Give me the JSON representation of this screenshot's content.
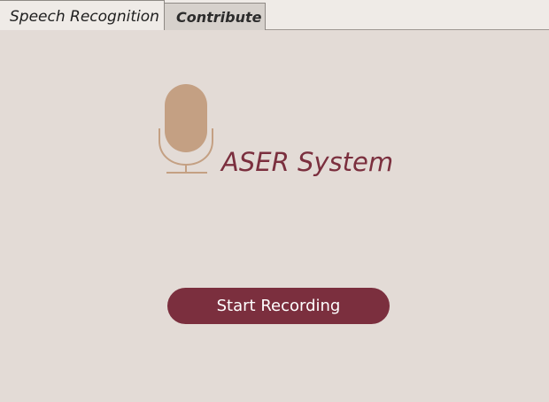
{
  "tabs": [
    {
      "label": "Speech Recognition",
      "active": true
    },
    {
      "label": "Contribute",
      "active": false
    }
  ],
  "main": {
    "logo_icon": "microphone-icon",
    "brand_title": "ASER System",
    "record_button_label": "Start Recording"
  },
  "colors": {
    "accent": "#7b2f3e",
    "mic_body": "#c4a083",
    "background": "#e3dbd6"
  }
}
